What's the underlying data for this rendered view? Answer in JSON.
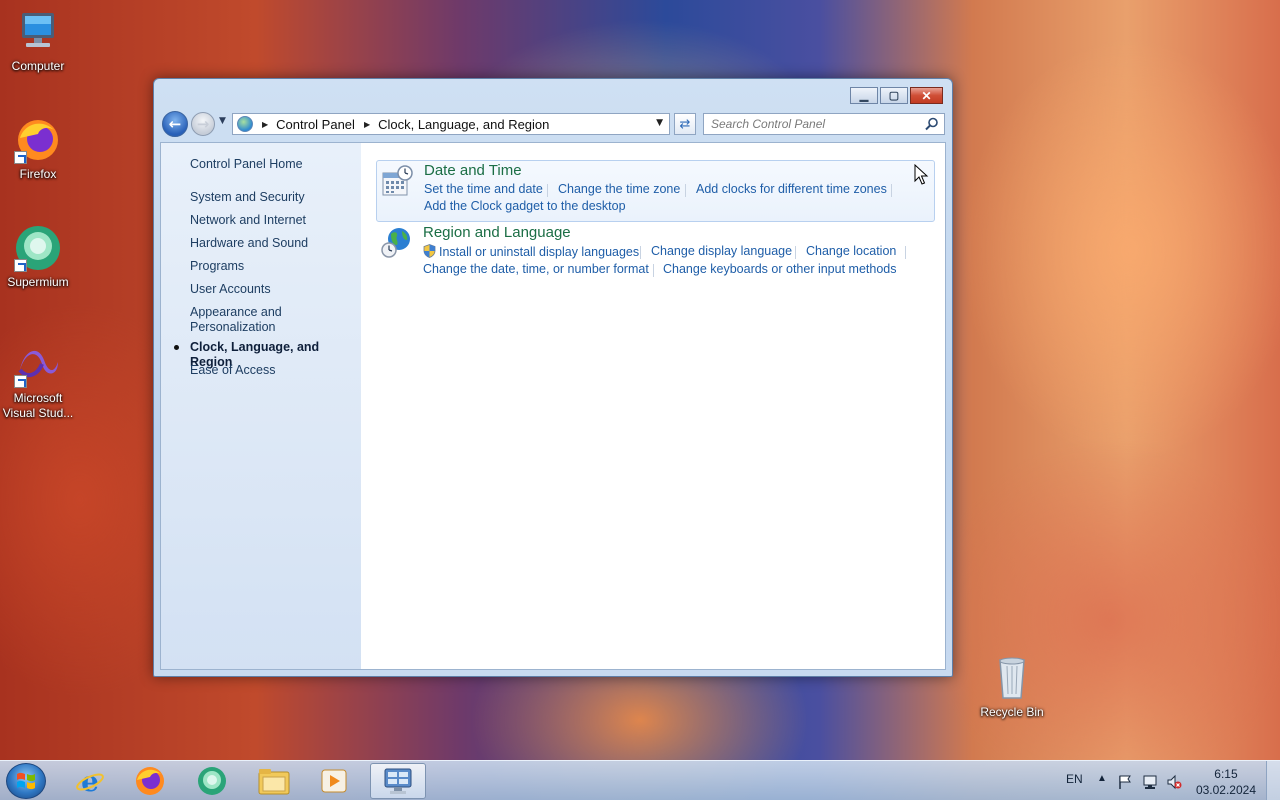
{
  "desktop": {
    "icons": [
      {
        "label": "Computer"
      },
      {
        "label": "Firefox"
      },
      {
        "label": "Supermium"
      },
      {
        "label": "Microsoft Visual Stud..."
      },
      {
        "label": "Recycle Bin"
      }
    ]
  },
  "window": {
    "caption_buttons": {
      "minimize": "▁",
      "maximize": "▢",
      "close": "✕"
    },
    "address": {
      "root": "Control Panel",
      "current": "Clock, Language, and Region"
    },
    "search": {
      "placeholder": "Search Control Panel"
    },
    "sidebar": {
      "home": "Control Panel Home",
      "items": [
        {
          "label": "System and Security"
        },
        {
          "label": "Network and Internet"
        },
        {
          "label": "Hardware and Sound"
        },
        {
          "label": "Programs"
        },
        {
          "label": "User Accounts"
        },
        {
          "label": "Appearance and Personalization"
        },
        {
          "label": "Clock, Language, and Region",
          "current": true
        },
        {
          "label": "Ease of Access"
        }
      ]
    },
    "categories": [
      {
        "title": "Date and Time",
        "icon": "calendar-clock-icon",
        "links": [
          "Set the time and date",
          "Change the time zone",
          "Add clocks for different time zones",
          "Add the Clock gadget to the desktop"
        ]
      },
      {
        "title": "Region and Language",
        "icon": "globe-clock-icon",
        "links": [
          "Install or uninstall display languages",
          "Change display language",
          "Change location",
          "Change the date, time, or number format",
          "Change keyboards or other input methods"
        ]
      }
    ]
  },
  "taskbar": {
    "language": "EN",
    "time": "6:15",
    "date": "03.02.2024",
    "apps": [
      "internet-explorer-icon",
      "firefox-icon",
      "supermium-icon",
      "file-explorer-icon",
      "media-player-icon",
      "control-panel-icon"
    ]
  }
}
